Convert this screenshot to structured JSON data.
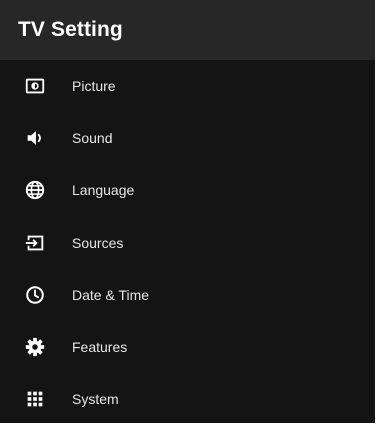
{
  "header": {
    "title": "TV Setting"
  },
  "colors": {
    "panel_background": "#141414",
    "header_background": "#272727",
    "text": "#e6e6e6",
    "icon": "#ffffff"
  },
  "menu": {
    "items": [
      {
        "label": "Picture",
        "icon": "picture-icon"
      },
      {
        "label": "Sound",
        "icon": "speaker-icon"
      },
      {
        "label": "Language",
        "icon": "globe-icon"
      },
      {
        "label": "Sources",
        "icon": "input-source-icon"
      },
      {
        "label": "Date & Time",
        "icon": "clock-icon"
      },
      {
        "label": "Features",
        "icon": "gear-icon"
      },
      {
        "label": "System",
        "icon": "grid-icon"
      }
    ]
  }
}
